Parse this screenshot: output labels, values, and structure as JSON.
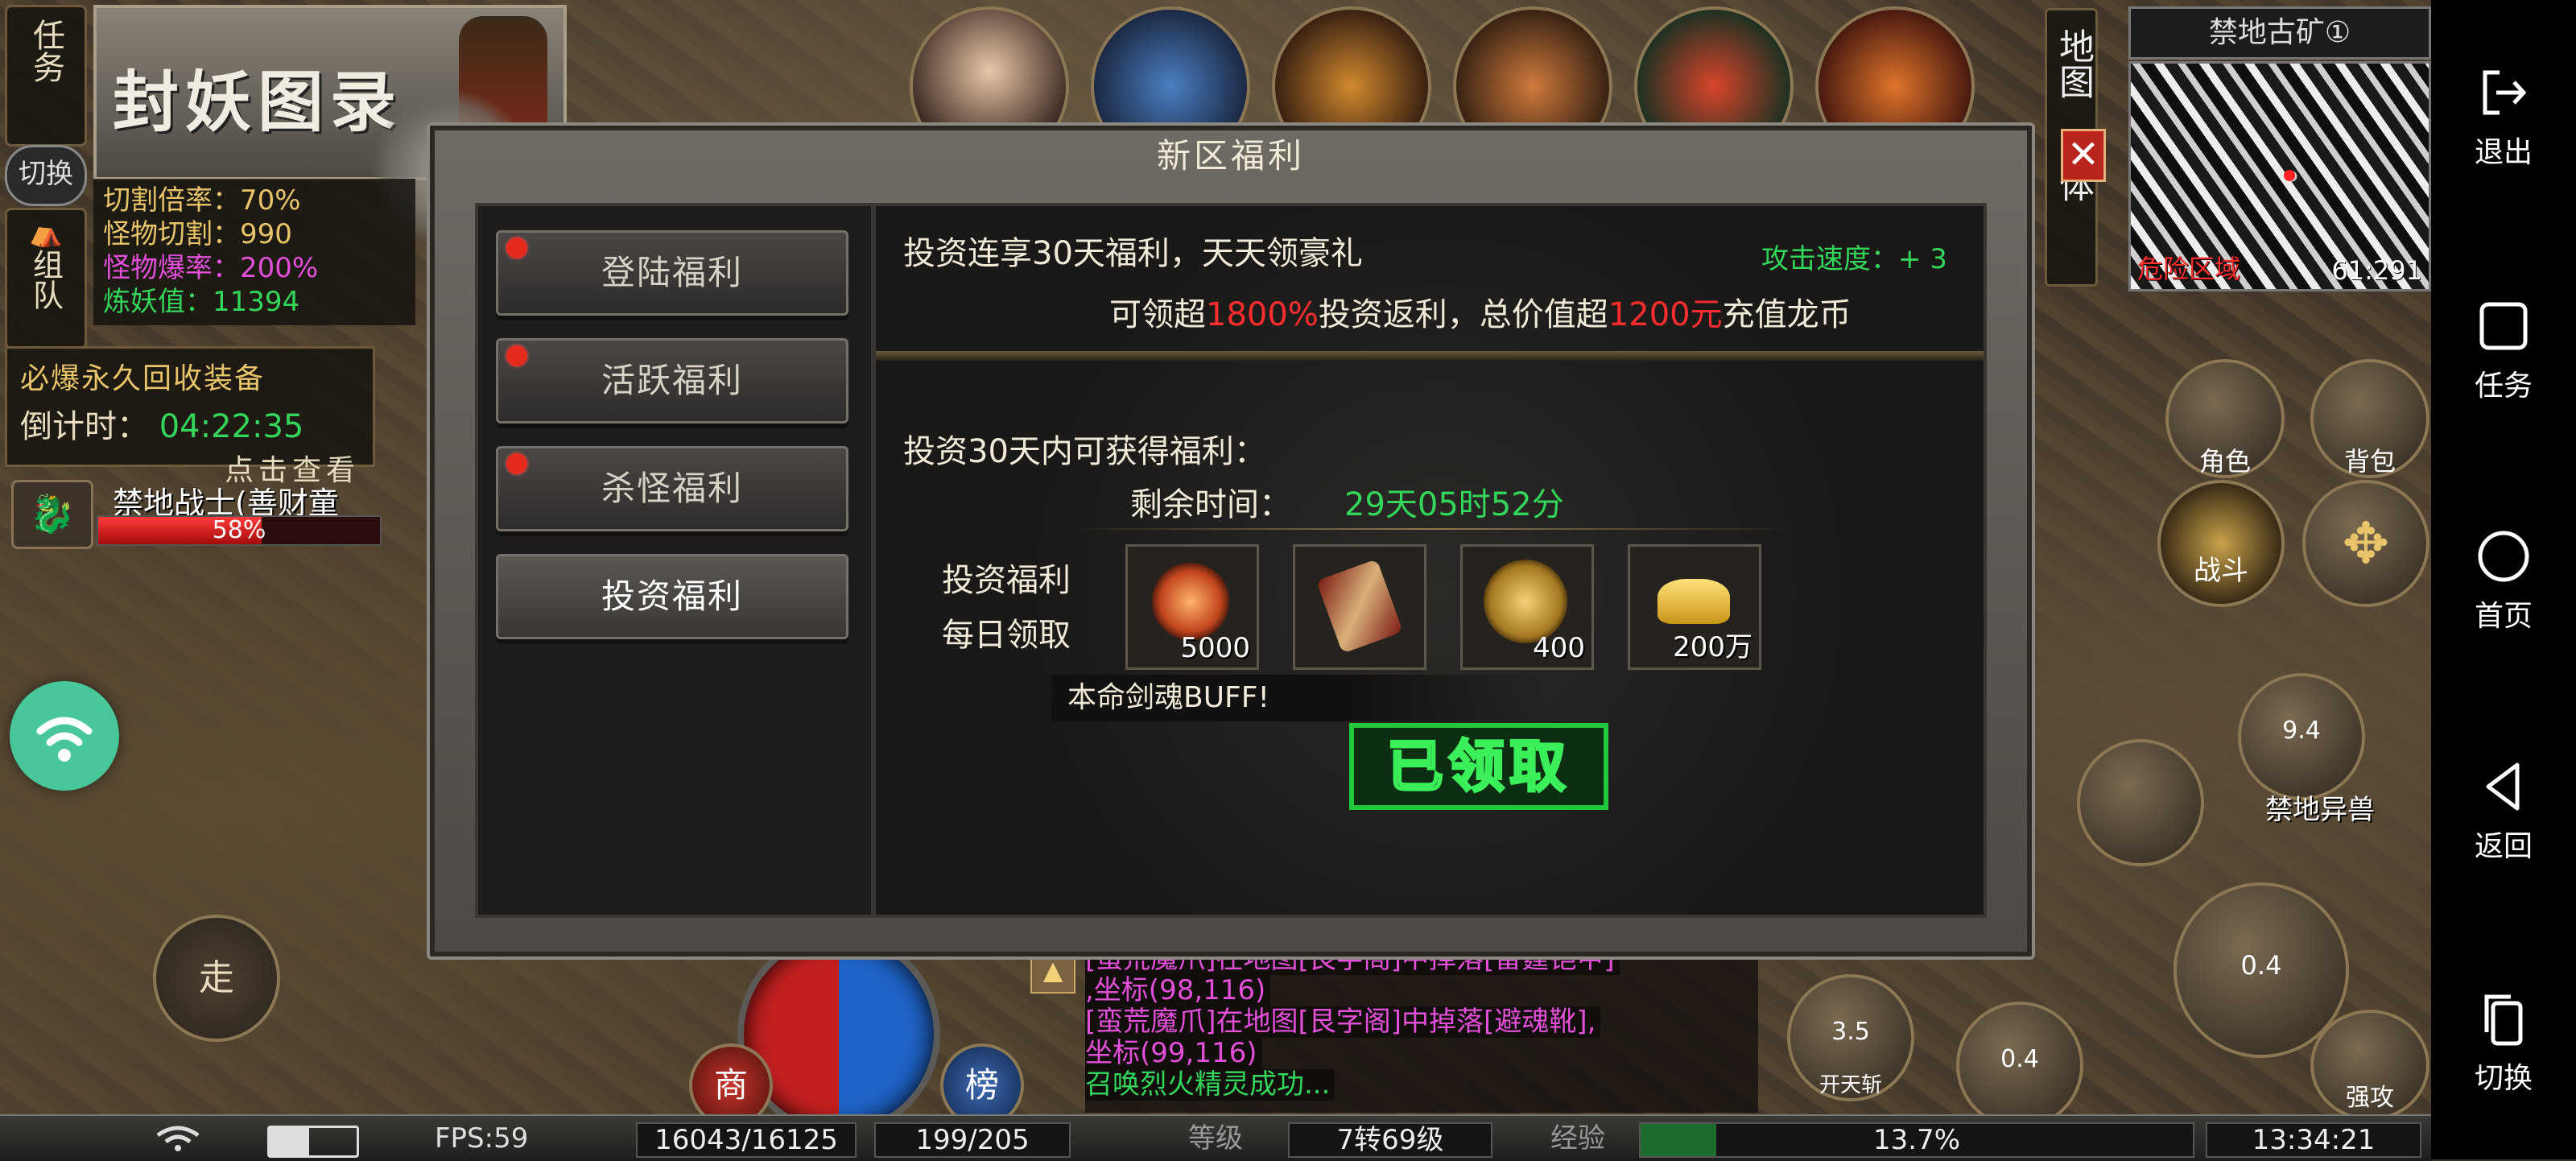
{
  "sidebar": {
    "exit": "退出",
    "task": "任务",
    "home": "首页",
    "back": "返回",
    "switch": "切换"
  },
  "topleft": {
    "task_btn": "任务",
    "switch_btn": "切换",
    "team_btn": "组队",
    "banner_title": "封妖图录",
    "stats": [
      "切割倍率：70%",
      "怪物切割：990",
      "怪物爆率：200%",
      "炼妖值：11394"
    ],
    "recycle_title": "必爆永久回收装备",
    "countdown_label": "倒计时：",
    "countdown_value": "04:22:35",
    "click_view": "点击查看",
    "target_name": "禁地战士(善财童",
    "target_hp": "58%",
    "target_hp_fraction": 0.58
  },
  "dialog": {
    "title": "新区福利",
    "close": "✕",
    "tabs": [
      {
        "label": "登陆福利",
        "badge": true
      },
      {
        "label": "活跃福利",
        "badge": true
      },
      {
        "label": "杀怪福利",
        "badge": true
      },
      {
        "label": "投资福利",
        "badge": false
      }
    ],
    "headline": "投资连享30天福利，天天领豪礼",
    "attack_speed": "攻击速度：+ 3",
    "rebate_a": "可领超",
    "rebate_pct": "1800%",
    "rebate_b": "投资返利，总价值超",
    "rebate_amount": "1200元",
    "rebate_c": "充值龙币",
    "gain_label": "投资30天内可获得福利：",
    "remain_label": "剩余时间：",
    "remain_value": "29天05时52分",
    "daily_label_1": "投资福利",
    "daily_label_2": "每日领取",
    "items": [
      "5000",
      "",
      "400",
      "200万"
    ],
    "buff": "本命剑魂BUFF!",
    "claimed": "已领取"
  },
  "topright": {
    "map_name": "禁地古矿①",
    "map_btn": "地图",
    "body_btn": "主体",
    "danger": "危险区域",
    "coords": "61:291",
    "role": "角色",
    "bag": "背包",
    "fight": "战斗",
    "monster": "禁地异兽",
    "skill_values": [
      "9.4",
      "3.5",
      "0.4",
      "0.4"
    ],
    "skill_name": "开天斩",
    "strong_attack": "强攻"
  },
  "left": {
    "walk": "走",
    "shop": "商",
    "rank": "榜"
  },
  "chat": {
    "lines": [
      {
        "text": "[蛮荒魔爪]在地图[艮字阁]中掉落[雷霆铠甲]",
        "color": "pink"
      },
      {
        "text": ",坐标(98,116)",
        "color": "pink"
      },
      {
        "text": "[蛮荒魔爪]在地图[艮字阁]中掉落[避魂靴],",
        "color": "pink"
      },
      {
        "text": "坐标(99,116)",
        "color": "pink"
      },
      {
        "text": "召唤烈火精灵成功...",
        "color": "green"
      }
    ]
  },
  "bottom": {
    "fps": "FPS:59",
    "hp": "16043/16125",
    "mp": "199/205",
    "level_label": "等级",
    "level_value": "7转69级",
    "exp_label": "经验",
    "exp_value": "13.7%",
    "exp_fraction": 0.137,
    "time": "13:34:21"
  },
  "colors": {
    "accent_green": "#33d65a",
    "accent_red": "#ff2d2d",
    "badge_red": "#e52a1e"
  }
}
